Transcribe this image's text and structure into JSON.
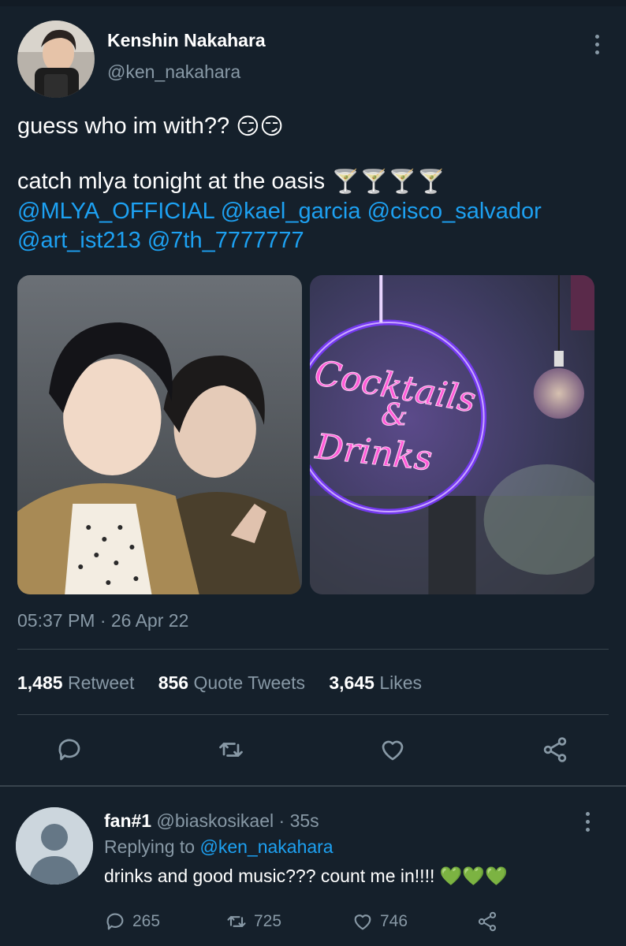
{
  "author": {
    "name": "Kenshin Nakahara",
    "handle": "@ken_nakahara"
  },
  "tweet": {
    "line1_text": "guess who im with??",
    "line1_emoji": "😏😏",
    "line2_text": "catch mlya tonight at the oasis",
    "line2_emoji": "🍸🍸🍸🍸",
    "mentions": [
      "@MLYA_OFFICIAL",
      "@kael_garcia",
      "@cisco_salvador",
      "@art_ist213",
      "@7th_7777777"
    ],
    "timestamp": "05:37 PM · 26 Apr 22"
  },
  "media": {
    "neon_word1": "Cocktails",
    "neon_amp": "&",
    "neon_word2": "Drinks"
  },
  "stats": {
    "retweets_count": "1,485",
    "retweets_label": "Retweet",
    "quotes_count": "856",
    "quotes_label": "Quote Tweets",
    "likes_count": "3,645",
    "likes_label": "Likes"
  },
  "reply": {
    "name": "fan#1",
    "handle": "@biaskosikael",
    "time": "· 35s",
    "replying_label": "Replying to",
    "replying_handle": "@ken_nakahara",
    "text": "drinks and good music??? count me in!!!!",
    "emoji": "💚💚💚",
    "reply_count": "265",
    "retweet_count": "725",
    "like_count": "746"
  },
  "icons": [
    "more-vertical-icon",
    "reply-icon",
    "retweet-icon",
    "like-icon",
    "share-icon"
  ],
  "colors": {
    "background": "#15202b",
    "link": "#1da1f2",
    "secondary_text": "#8899a6",
    "divider": "#38444d"
  }
}
